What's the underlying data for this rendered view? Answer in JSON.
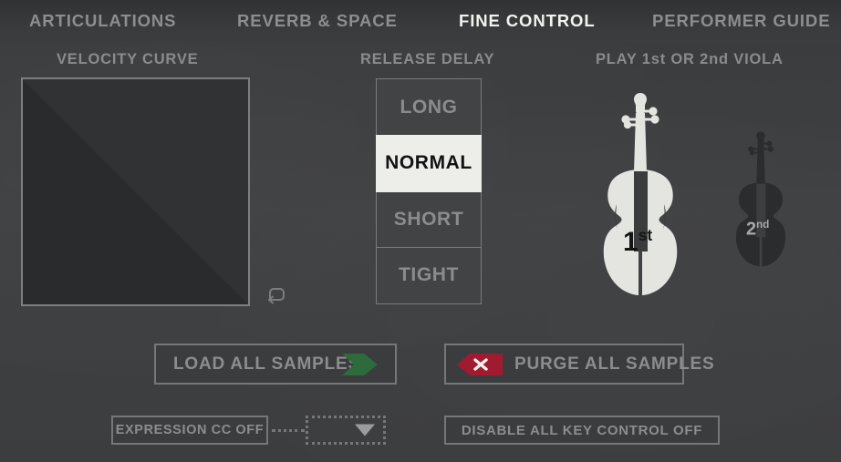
{
  "nav": {
    "tabs": [
      {
        "label": "ARTICULATIONS",
        "active": false
      },
      {
        "label": "REVERB & SPACE",
        "active": false
      },
      {
        "label": "FINE CONTROL",
        "active": true
      },
      {
        "label": "PERFORMER GUIDE",
        "active": false
      }
    ]
  },
  "velocity": {
    "title": "VELOCITY CURVE",
    "reset_icon": "reset-loop-arrow-icon",
    "curve_type": "linear-diagonal"
  },
  "release": {
    "title": "RELEASE DELAY",
    "selected": "NORMAL",
    "options": [
      {
        "label": "LONG",
        "selected": false
      },
      {
        "label": "NORMAL",
        "selected": true
      },
      {
        "label": "SHORT",
        "selected": false
      },
      {
        "label": "TIGHT",
        "selected": false
      }
    ]
  },
  "viola": {
    "title": "PLAY 1st OR 2nd VIOLA",
    "first": {
      "badge_number": "1",
      "badge_suffix": "st",
      "active": true
    },
    "second": {
      "badge_number": "2",
      "badge_suffix": "nd",
      "active": false
    }
  },
  "actions": {
    "load_label": "LOAD ALL SAMPLES",
    "load_icon": "green-chevron-arrow-icon",
    "load_icon_color": "#2e6b3c",
    "purge_label": "PURGE ALL SAMPLES",
    "purge_icon": "red-tag-x-icon",
    "purge_icon_color": "#a01b30"
  },
  "bottom": {
    "expression_label": "EXPRESSION CC OFF",
    "dropdown_value": "",
    "dropdown_caret_icon": "chevron-down-icon",
    "keycontrol_label": "DISABLE ALL KEY CONTROL OFF"
  },
  "theme": {
    "background": "#3b3c3e",
    "text_dim": "#8c8d8f",
    "text_active": "#f2f2ee",
    "panel_border": "#76777a",
    "selected_bg": "#edeeea"
  }
}
